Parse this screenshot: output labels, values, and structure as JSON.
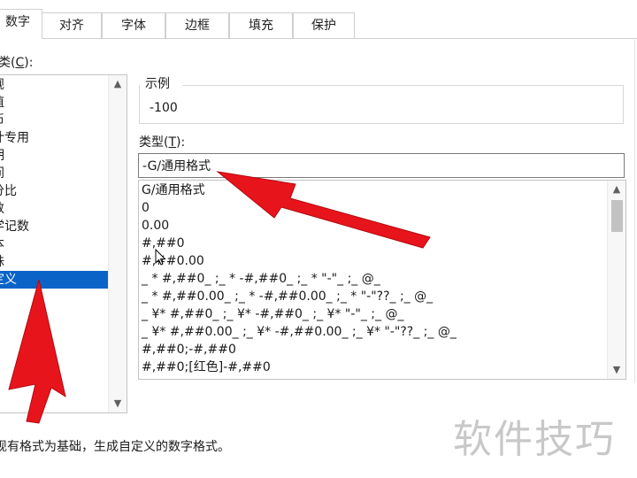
{
  "tabs": [
    {
      "label": "数字",
      "active": true
    },
    {
      "label": "对齐",
      "active": false
    },
    {
      "label": "字体",
      "active": false
    },
    {
      "label": "边框",
      "active": false
    },
    {
      "label": "填充",
      "active": false
    },
    {
      "label": "保护",
      "active": false
    }
  ],
  "category": {
    "label_prefix": "类(",
    "label_key": "C",
    "label_suffix": "):",
    "items": [
      "规",
      "值",
      "币",
      "计专用",
      "期",
      "间",
      "分比",
      "数",
      "学记数",
      "本",
      "殊",
      "定义"
    ],
    "selected": "定义"
  },
  "sample": {
    "legend": "示例",
    "value": "-100"
  },
  "type": {
    "label_prefix": "类型(",
    "label_key": "T",
    "label_suffix": "):",
    "input_value": "-G/通用格式"
  },
  "formats": [
    "G/通用格式",
    "0",
    "0.00",
    "#,##0",
    "#,##0.00",
    "_ * #,##0_ ;_ * -#,##0_ ;_ * \"-\"_ ;_ @_ ",
    "_ * #,##0.00_ ;_ * -#,##0.00_ ;_ * \"-\"??_ ;_ @_ ",
    "_ ¥* #,##0_ ;_ ¥* -#,##0_ ;_ ¥* \"-\"_ ;_ @_ ",
    "_ ¥* #,##0.00_ ;_ ¥* -#,##0.00_ ;_ ¥* \"-\"??_ ;_ @_ ",
    "#,##0;-#,##0",
    "#,##0;[红色]-#,##0"
  ],
  "description": "现有格式为基础，生成自定义的数字格式。",
  "watermark": "软件技巧",
  "colors": {
    "selection": "#0a64c8",
    "annotation_arrow": "#e8141c"
  }
}
